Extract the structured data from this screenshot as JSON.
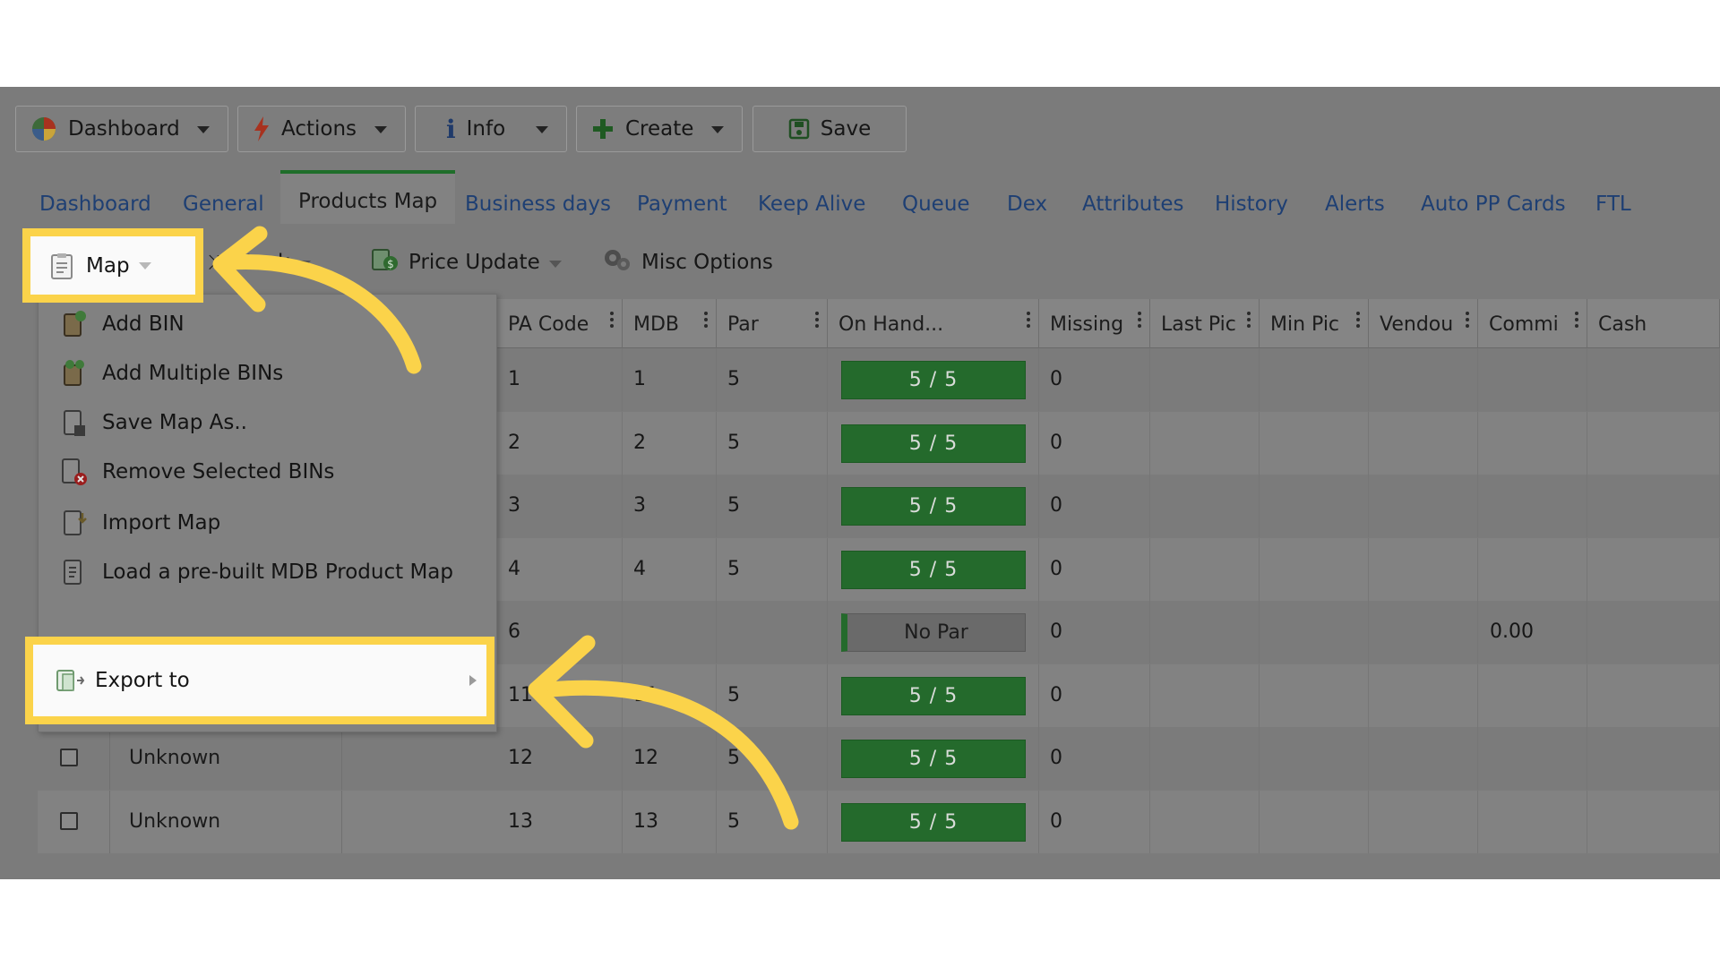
{
  "toolbar": {
    "dashboard": "Dashboard",
    "actions": "Actions",
    "info": "Info",
    "create": "Create",
    "save": "Save"
  },
  "tabs": [
    "Dashboard",
    "General",
    "Products Map",
    "Business days",
    "Payment",
    "Keep Alive",
    "Queue",
    "Dex",
    "Attributes",
    "History",
    "Alerts",
    "Auto PP Cards",
    "FTL"
  ],
  "active_tab": "Products Map",
  "subtoolbar": {
    "map": "Map",
    "stock": "Stock",
    "price_update": "Price Update",
    "misc_options": "Misc Options"
  },
  "map_menu": {
    "items": [
      "Add BIN",
      "Add Multiple BINs",
      "Save Map As..",
      "Remove Selected BINs",
      "Import Map",
      "Load a pre-built MDB Product Map",
      "Export to"
    ]
  },
  "columns": [
    "PA Code",
    "MDB",
    "Par",
    "On Hand...",
    "Missing",
    "Last Pic",
    "Min Pic",
    "Vendou",
    "Commi",
    "Cash"
  ],
  "rows": [
    {
      "pa_code": "1",
      "mdb": "1",
      "par": "5",
      "on_hand": "5 / 5",
      "missing": "0",
      "commission": "",
      "name": ""
    },
    {
      "pa_code": "2",
      "mdb": "2",
      "par": "5",
      "on_hand": "5 / 5",
      "missing": "0",
      "commission": "",
      "name": ""
    },
    {
      "pa_code": "3",
      "mdb": "3",
      "par": "5",
      "on_hand": "5 / 5",
      "missing": "0",
      "commission": "",
      "name": ""
    },
    {
      "pa_code": "4",
      "mdb": "4",
      "par": "5",
      "on_hand": "5 / 5",
      "missing": "0",
      "commission": "",
      "name": ""
    },
    {
      "pa_code": "6",
      "mdb": "",
      "par": "",
      "on_hand": "No Par",
      "missing": "0",
      "commission": "0.00",
      "name": ""
    },
    {
      "pa_code": "11",
      "mdb": "11",
      "par": "5",
      "on_hand": "5 / 5",
      "missing": "0",
      "commission": "",
      "name": ""
    },
    {
      "pa_code": "12",
      "mdb": "12",
      "par": "5",
      "on_hand": "5 / 5",
      "missing": "0",
      "commission": "",
      "name": "Unknown"
    },
    {
      "pa_code": "13",
      "mdb": "13",
      "par": "5",
      "on_hand": "5 / 5",
      "missing": "0",
      "commission": "",
      "name": "Unknown"
    }
  ],
  "colors": {
    "highlight": "#fbd34a",
    "onhand_green": "#246a2c",
    "tab_text": "#1e3f73"
  }
}
